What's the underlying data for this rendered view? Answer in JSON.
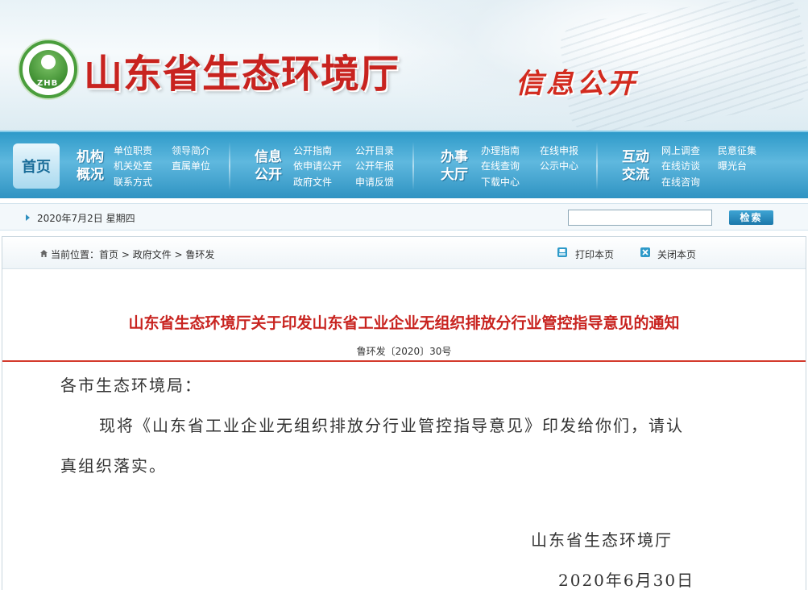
{
  "header": {
    "logo_text": "ZHB",
    "site_title": "山东省生态环境厅",
    "section_title": "信息公开"
  },
  "nav": {
    "home": "首页",
    "groups": [
      {
        "title_line1": "机构",
        "title_line2": "概况",
        "links": [
          "单位职责",
          "领导简介",
          "机关处室",
          "直属单位",
          "联系方式"
        ]
      },
      {
        "title_line1": "信息",
        "title_line2": "公开",
        "links": [
          "公开指南",
          "公开目录",
          "依申请公开",
          "公开年报",
          "政府文件",
          "申请反馈"
        ]
      },
      {
        "title_line1": "办事",
        "title_line2": "大厅",
        "links": [
          "办理指南",
          "在线申报",
          "在线查询",
          "公示中心",
          "下载中心"
        ]
      },
      {
        "title_line1": "互动",
        "title_line2": "交流",
        "links": [
          "网上调查",
          "民意征集",
          "在线访谈",
          "曝光台",
          "在线咨询"
        ]
      }
    ]
  },
  "datebar": {
    "date": "2020年7月2日 星期四",
    "search_value": "",
    "search_button": "检索"
  },
  "breadcrumb": {
    "label": "当前位置：",
    "items": [
      "首页",
      "政府文件",
      "鲁环发"
    ],
    "separator": " > "
  },
  "tools": {
    "print": "打印本页",
    "close": "关闭本页"
  },
  "article": {
    "title": "山东省生态环境厅关于印发山东省工业企业无组织排放分行业管控指导意见的通知",
    "doc_no": "鲁环发〔2020〕30号",
    "salutation": "各市生态环境局：",
    "para_line1": "现将《山东省工业企业无组织排放分行业管控指导意见》印发给你们，请认",
    "para_line2": "真组织落实。",
    "signature": "山东省生态环境厅",
    "date": "2020年6月30日"
  },
  "colors": {
    "title_red": "#c8231f",
    "nav_blue": "#2e9ac9",
    "divider_red": "#d43a2c"
  }
}
